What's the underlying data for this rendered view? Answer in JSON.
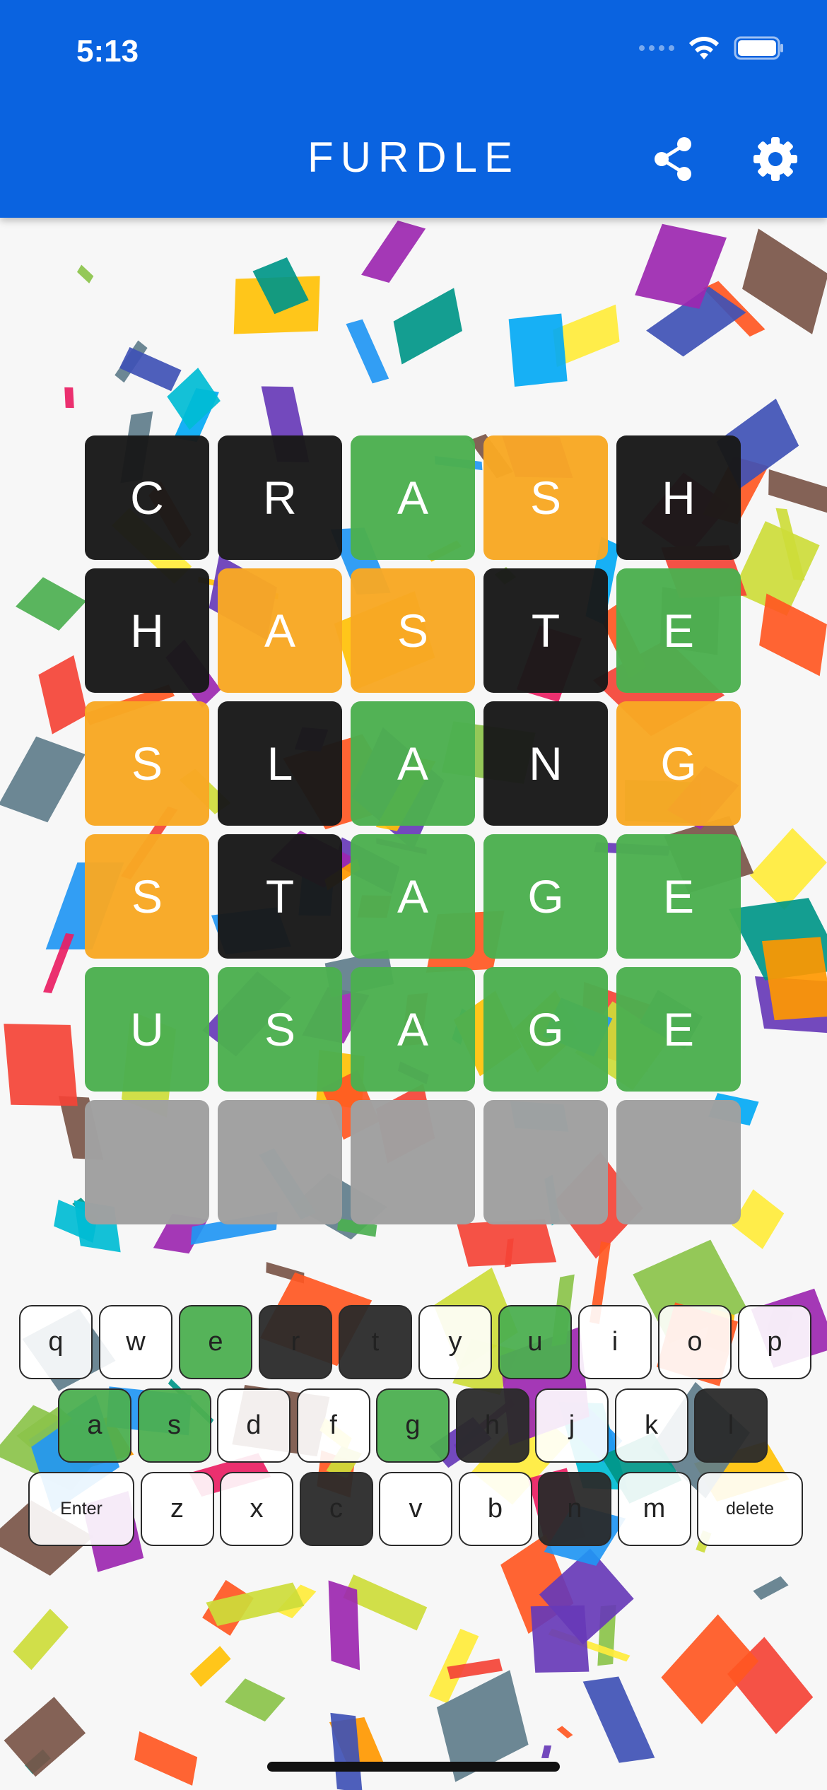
{
  "status_bar": {
    "time": "5:13"
  },
  "app": {
    "title": "FURDLE"
  },
  "header": {
    "icons": [
      "share-icon",
      "settings-icon"
    ]
  },
  "board": {
    "rows": [
      [
        {
          "letter": "C",
          "state": "absent"
        },
        {
          "letter": "R",
          "state": "absent"
        },
        {
          "letter": "A",
          "state": "correct"
        },
        {
          "letter": "S",
          "state": "present"
        },
        {
          "letter": "H",
          "state": "absent"
        }
      ],
      [
        {
          "letter": "H",
          "state": "absent"
        },
        {
          "letter": "A",
          "state": "present"
        },
        {
          "letter": "S",
          "state": "present"
        },
        {
          "letter": "T",
          "state": "absent"
        },
        {
          "letter": "E",
          "state": "correct"
        }
      ],
      [
        {
          "letter": "S",
          "state": "present"
        },
        {
          "letter": "L",
          "state": "absent"
        },
        {
          "letter": "A",
          "state": "correct"
        },
        {
          "letter": "N",
          "state": "absent"
        },
        {
          "letter": "G",
          "state": "present"
        }
      ],
      [
        {
          "letter": "S",
          "state": "present"
        },
        {
          "letter": "T",
          "state": "absent"
        },
        {
          "letter": "A",
          "state": "correct"
        },
        {
          "letter": "G",
          "state": "correct"
        },
        {
          "letter": "E",
          "state": "correct"
        }
      ],
      [
        {
          "letter": "U",
          "state": "correct"
        },
        {
          "letter": "S",
          "state": "correct"
        },
        {
          "letter": "A",
          "state": "correct"
        },
        {
          "letter": "G",
          "state": "correct"
        },
        {
          "letter": "E",
          "state": "correct"
        }
      ],
      [
        {
          "letter": "",
          "state": "empty"
        },
        {
          "letter": "",
          "state": "empty"
        },
        {
          "letter": "",
          "state": "empty"
        },
        {
          "letter": "",
          "state": "empty"
        },
        {
          "letter": "",
          "state": "empty"
        }
      ]
    ]
  },
  "keyboard": {
    "rows": [
      [
        {
          "label": "q",
          "state": "unused"
        },
        {
          "label": "w",
          "state": "unused"
        },
        {
          "label": "e",
          "state": "correct"
        },
        {
          "label": "r",
          "state": "absent"
        },
        {
          "label": "t",
          "state": "absent"
        },
        {
          "label": "y",
          "state": "unused"
        },
        {
          "label": "u",
          "state": "correct"
        },
        {
          "label": "i",
          "state": "unused"
        },
        {
          "label": "o",
          "state": "unused"
        },
        {
          "label": "p",
          "state": "unused"
        }
      ],
      [
        {
          "label": "a",
          "state": "correct"
        },
        {
          "label": "s",
          "state": "correct"
        },
        {
          "label": "d",
          "state": "unused"
        },
        {
          "label": "f",
          "state": "unused"
        },
        {
          "label": "g",
          "state": "correct"
        },
        {
          "label": "h",
          "state": "absent"
        },
        {
          "label": "j",
          "state": "unused"
        },
        {
          "label": "k",
          "state": "unused"
        },
        {
          "label": "l",
          "state": "absent"
        }
      ],
      [
        {
          "label": "Enter",
          "state": "unused"
        },
        {
          "label": "z",
          "state": "unused"
        },
        {
          "label": "x",
          "state": "unused"
        },
        {
          "label": "c",
          "state": "absent"
        },
        {
          "label": "v",
          "state": "unused"
        },
        {
          "label": "b",
          "state": "unused"
        },
        {
          "label": "n",
          "state": "absent"
        },
        {
          "label": "m",
          "state": "unused"
        },
        {
          "label": "delete",
          "state": "unused"
        }
      ]
    ]
  },
  "colors": {
    "header": "#0a63e0",
    "correct": "#4caf50",
    "present": "#f8a824",
    "absent": "#191919",
    "empty": "#a0a0a0",
    "confetti": [
      "#f44336",
      "#e91e63",
      "#9c27b0",
      "#673ab7",
      "#3f51b5",
      "#2196f3",
      "#03a9f4",
      "#00bcd4",
      "#009688",
      "#4caf50",
      "#8bc34a",
      "#cddc39",
      "#ffeb3b",
      "#ffc107",
      "#ff9800",
      "#ff5722",
      "#795548",
      "#607d8b"
    ]
  }
}
